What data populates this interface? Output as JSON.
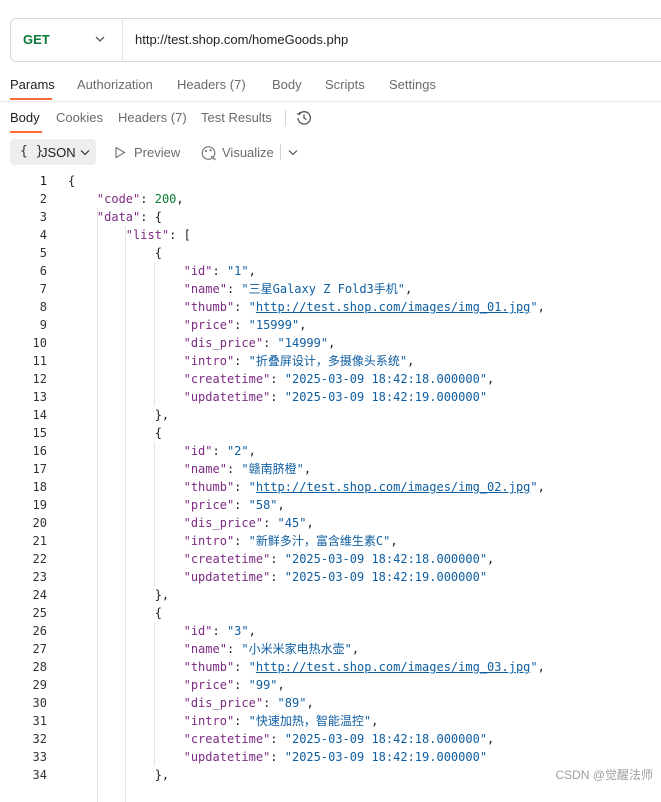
{
  "request": {
    "method": "GET",
    "url": "http://test.shop.com/homeGoods.php",
    "tabs": [
      {
        "label": "Params",
        "count": ""
      },
      {
        "label": "Authorization",
        "count": ""
      },
      {
        "label": "Headers",
        "count": "(7)"
      },
      {
        "label": "Body",
        "count": ""
      },
      {
        "label": "Scripts",
        "count": ""
      },
      {
        "label": "Settings",
        "count": ""
      }
    ]
  },
  "response": {
    "tabs": [
      {
        "label": "Body",
        "count": ""
      },
      {
        "label": "Cookies",
        "count": ""
      },
      {
        "label": "Headers",
        "count": "(7)"
      },
      {
        "label": "Test Results",
        "count": ""
      }
    ],
    "format": {
      "braces": "{ }",
      "label": "JSON"
    },
    "preview_label": "Preview",
    "visualize_label": "Visualize"
  },
  "code_lines": [
    {
      "n": "1",
      "parts": [
        {
          "t": "{"
        }
      ]
    },
    {
      "n": "2",
      "parts": [
        {
          "t": "    "
        },
        {
          "k": "\"code\""
        },
        {
          "t": ": "
        },
        {
          "num": "200"
        },
        {
          "t": ","
        }
      ]
    },
    {
      "n": "3",
      "parts": [
        {
          "t": "    "
        },
        {
          "k": "\"data\""
        },
        {
          "t": ": {"
        }
      ]
    },
    {
      "n": "4",
      "parts": [
        {
          "t": "        "
        },
        {
          "k": "\"list\""
        },
        {
          "t": ": ["
        }
      ]
    },
    {
      "n": "5",
      "parts": [
        {
          "t": "            {"
        }
      ]
    },
    {
      "n": "6",
      "parts": [
        {
          "t": "                "
        },
        {
          "k": "\"id\""
        },
        {
          "t": ": "
        },
        {
          "s": "\"1\""
        },
        {
          "t": ","
        }
      ]
    },
    {
      "n": "7",
      "parts": [
        {
          "t": "                "
        },
        {
          "k": "\"name\""
        },
        {
          "t": ": "
        },
        {
          "s": "\"三星Galaxy Z Fold3手机\""
        },
        {
          "t": ","
        }
      ]
    },
    {
      "n": "8",
      "parts": [
        {
          "t": "                "
        },
        {
          "k": "\"thumb\""
        },
        {
          "t": ": "
        },
        {
          "s": "\""
        },
        {
          "link": "http://test.shop.com/images/img_01.jpg"
        },
        {
          "s": "\""
        },
        {
          "t": ","
        }
      ]
    },
    {
      "n": "9",
      "parts": [
        {
          "t": "                "
        },
        {
          "k": "\"price\""
        },
        {
          "t": ": "
        },
        {
          "s": "\"15999\""
        },
        {
          "t": ","
        }
      ]
    },
    {
      "n": "10",
      "parts": [
        {
          "t": "                "
        },
        {
          "k": "\"dis_price\""
        },
        {
          "t": ": "
        },
        {
          "s": "\"14999\""
        },
        {
          "t": ","
        }
      ]
    },
    {
      "n": "11",
      "parts": [
        {
          "t": "                "
        },
        {
          "k": "\"intro\""
        },
        {
          "t": ": "
        },
        {
          "s": "\"折叠屏设计，多摄像头系统\""
        },
        {
          "t": ","
        }
      ]
    },
    {
      "n": "12",
      "parts": [
        {
          "t": "                "
        },
        {
          "k": "\"createtime\""
        },
        {
          "t": ": "
        },
        {
          "s": "\"2025-03-09 18:42:18.000000\""
        },
        {
          "t": ","
        }
      ]
    },
    {
      "n": "13",
      "parts": [
        {
          "t": "                "
        },
        {
          "k": "\"updatetime\""
        },
        {
          "t": ": "
        },
        {
          "s": "\"2025-03-09 18:42:19.000000\""
        }
      ]
    },
    {
      "n": "14",
      "parts": [
        {
          "t": "            },"
        }
      ]
    },
    {
      "n": "15",
      "parts": [
        {
          "t": "            {"
        }
      ]
    },
    {
      "n": "16",
      "parts": [
        {
          "t": "                "
        },
        {
          "k": "\"id\""
        },
        {
          "t": ": "
        },
        {
          "s": "\"2\""
        },
        {
          "t": ","
        }
      ]
    },
    {
      "n": "17",
      "parts": [
        {
          "t": "                "
        },
        {
          "k": "\"name\""
        },
        {
          "t": ": "
        },
        {
          "s": "\"赣南脐橙\""
        },
        {
          "t": ","
        }
      ]
    },
    {
      "n": "18",
      "parts": [
        {
          "t": "                "
        },
        {
          "k": "\"thumb\""
        },
        {
          "t": ": "
        },
        {
          "s": "\""
        },
        {
          "link": "http://test.shop.com/images/img_02.jpg"
        },
        {
          "s": "\""
        },
        {
          "t": ","
        }
      ]
    },
    {
      "n": "19",
      "parts": [
        {
          "t": "                "
        },
        {
          "k": "\"price\""
        },
        {
          "t": ": "
        },
        {
          "s": "\"58\""
        },
        {
          "t": ","
        }
      ]
    },
    {
      "n": "20",
      "parts": [
        {
          "t": "                "
        },
        {
          "k": "\"dis_price\""
        },
        {
          "t": ": "
        },
        {
          "s": "\"45\""
        },
        {
          "t": ","
        }
      ]
    },
    {
      "n": "21",
      "parts": [
        {
          "t": "                "
        },
        {
          "k": "\"intro\""
        },
        {
          "t": ": "
        },
        {
          "s": "\"新鲜多汁，富含维生素C\""
        },
        {
          "t": ","
        }
      ]
    },
    {
      "n": "22",
      "parts": [
        {
          "t": "                "
        },
        {
          "k": "\"createtime\""
        },
        {
          "t": ": "
        },
        {
          "s": "\"2025-03-09 18:42:18.000000\""
        },
        {
          "t": ","
        }
      ]
    },
    {
      "n": "23",
      "parts": [
        {
          "t": "                "
        },
        {
          "k": "\"updatetime\""
        },
        {
          "t": ": "
        },
        {
          "s": "\"2025-03-09 18:42:19.000000\""
        }
      ]
    },
    {
      "n": "24",
      "parts": [
        {
          "t": "            },"
        }
      ]
    },
    {
      "n": "25",
      "parts": [
        {
          "t": "            {"
        }
      ]
    },
    {
      "n": "26",
      "parts": [
        {
          "t": "                "
        },
        {
          "k": "\"id\""
        },
        {
          "t": ": "
        },
        {
          "s": "\"3\""
        },
        {
          "t": ","
        }
      ]
    },
    {
      "n": "27",
      "parts": [
        {
          "t": "                "
        },
        {
          "k": "\"name\""
        },
        {
          "t": ": "
        },
        {
          "s": "\"小米米家电热水壶\""
        },
        {
          "t": ","
        }
      ]
    },
    {
      "n": "28",
      "parts": [
        {
          "t": "                "
        },
        {
          "k": "\"thumb\""
        },
        {
          "t": ": "
        },
        {
          "s": "\""
        },
        {
          "link": "http://test.shop.com/images/img_03.jpg"
        },
        {
          "s": "\""
        },
        {
          "t": ","
        }
      ]
    },
    {
      "n": "29",
      "parts": [
        {
          "t": "                "
        },
        {
          "k": "\"price\""
        },
        {
          "t": ": "
        },
        {
          "s": "\"99\""
        },
        {
          "t": ","
        }
      ]
    },
    {
      "n": "30",
      "parts": [
        {
          "t": "                "
        },
        {
          "k": "\"dis_price\""
        },
        {
          "t": ": "
        },
        {
          "s": "\"89\""
        },
        {
          "t": ","
        }
      ]
    },
    {
      "n": "31",
      "parts": [
        {
          "t": "                "
        },
        {
          "k": "\"intro\""
        },
        {
          "t": ": "
        },
        {
          "s": "\"快速加热，智能温控\""
        },
        {
          "t": ","
        }
      ]
    },
    {
      "n": "32",
      "parts": [
        {
          "t": "                "
        },
        {
          "k": "\"createtime\""
        },
        {
          "t": ": "
        },
        {
          "s": "\"2025-03-09 18:42:18.000000\""
        },
        {
          "t": ","
        }
      ]
    },
    {
      "n": "33",
      "parts": [
        {
          "t": "                "
        },
        {
          "k": "\"updatetime\""
        },
        {
          "t": ": "
        },
        {
          "s": "\"2025-03-09 18:42:19.000000\""
        }
      ]
    },
    {
      "n": "34",
      "parts": [
        {
          "t": "            },"
        }
      ]
    }
  ],
  "watermark": "CSDN @觉醒法师",
  "icons": {
    "method_dropdown": "chevron-down-icon",
    "history": "history-icon",
    "format": "braces-icon",
    "preview": "play-icon",
    "visualize": "visualize-icon"
  },
  "colors": {
    "accent": "#ff6c37",
    "method_get": "#0a7a37",
    "json_key": "#7c2a83",
    "json_string": "#0e5ea1",
    "json_number": "#0a7a37"
  }
}
